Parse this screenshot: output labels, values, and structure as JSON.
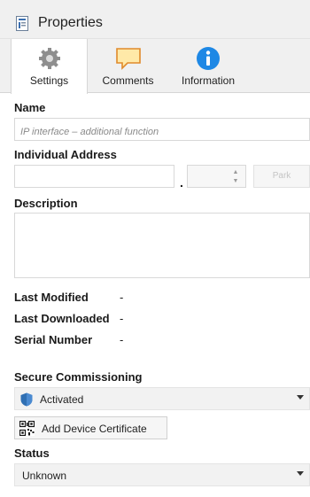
{
  "panel": {
    "title": "Properties",
    "icon": "properties-icon"
  },
  "tabs": [
    {
      "label": "Settings",
      "icon": "gear-icon",
      "active": true
    },
    {
      "label": "Comments",
      "icon": "comment-icon",
      "active": false
    },
    {
      "label": "Information",
      "icon": "info-icon",
      "active": false
    }
  ],
  "name": {
    "label": "Name",
    "placeholder": "IP interface – additional function"
  },
  "address": {
    "label": "Individual Address",
    "value": "",
    "dot": ".",
    "park_label": "Park"
  },
  "description": {
    "label": "Description",
    "value": ""
  },
  "meta": [
    {
      "label": "Last Modified",
      "value": "-"
    },
    {
      "label": "Last Downloaded",
      "value": "-"
    },
    {
      "label": "Serial Number",
      "value": "-"
    }
  ],
  "secure": {
    "label": "Secure Commissioning",
    "selected": "Activated",
    "icon": "shield-icon"
  },
  "certificate_button": {
    "label": "Add Device Certificate",
    "icon": "qr-code-icon"
  },
  "status": {
    "label": "Status",
    "selected": "Unknown"
  },
  "colors": {
    "shield": "#2f6fb3",
    "info": "#1e88e5",
    "comment": "#f0a040"
  }
}
